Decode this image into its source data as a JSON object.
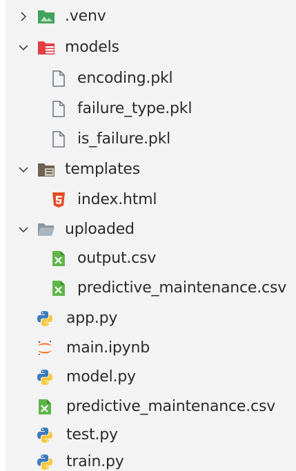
{
  "tree": {
    "items": [
      {
        "label": ".venv",
        "kind": "folder",
        "icon": "env-folder-icon",
        "twisty": "chevron-right-icon",
        "color": "#4aa564"
      },
      {
        "label": "models",
        "kind": "folder",
        "icon": "models-folder-icon",
        "twisty": "chevron-down-icon",
        "color": "#e8474c"
      },
      {
        "label": "encoding.pkl",
        "kind": "file",
        "icon": "file-icon"
      },
      {
        "label": "failure_type.pkl",
        "kind": "file",
        "icon": "file-icon"
      },
      {
        "label": "is_failure.pkl",
        "kind": "file",
        "icon": "file-icon"
      },
      {
        "label": "templates",
        "kind": "folder",
        "icon": "templates-folder-icon",
        "twisty": "chevron-down-icon",
        "color": "#7a6a5a"
      },
      {
        "label": "index.html",
        "kind": "file",
        "icon": "html5-icon",
        "color": "#e44d26"
      },
      {
        "label": "uploaded",
        "kind": "folder",
        "icon": "folder-open-icon",
        "twisty": "chevron-down-icon",
        "color": "#8d9aa6"
      },
      {
        "label": "output.csv",
        "kind": "file",
        "icon": "csv-icon",
        "color": "#5fb54a"
      },
      {
        "label": "predictive_maintenance.csv",
        "kind": "file",
        "icon": "csv-icon",
        "color": "#5fb54a"
      },
      {
        "label": "app.py",
        "kind": "file",
        "icon": "python-icon"
      },
      {
        "label": "main.ipynb",
        "kind": "file",
        "icon": "jupyter-icon",
        "color": "#f37726"
      },
      {
        "label": "model.py",
        "kind": "file",
        "icon": "python-icon"
      },
      {
        "label": "predictive_maintenance.csv",
        "kind": "file",
        "icon": "csv-icon",
        "color": "#5fb54a"
      },
      {
        "label": "test.py",
        "kind": "file",
        "icon": "python-icon"
      },
      {
        "label": "train.py",
        "kind": "file",
        "icon": "python-icon"
      }
    ]
  }
}
